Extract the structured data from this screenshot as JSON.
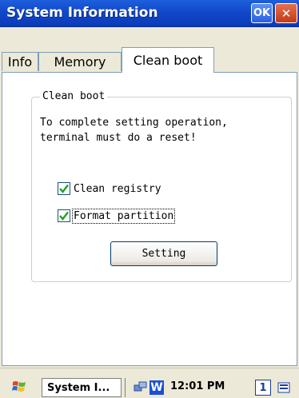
{
  "window": {
    "title": "System Information",
    "ok_label": "OK",
    "close_label": "✕"
  },
  "tabs": [
    {
      "label": "Info"
    },
    {
      "label": "Memory"
    },
    {
      "label": "Clean boot"
    }
  ],
  "group": {
    "legend": "Clean boot",
    "message": "To complete setting operation, terminal must do a reset!",
    "checkboxes": [
      {
        "label": "Clean registry",
        "checked": true
      },
      {
        "label": "Format partition",
        "checked": true
      }
    ],
    "button_label": "Setting"
  },
  "taskbar": {
    "task_label": "System I...",
    "clock": "12:01 PM",
    "kb_label": "1",
    "w_label": "W"
  }
}
